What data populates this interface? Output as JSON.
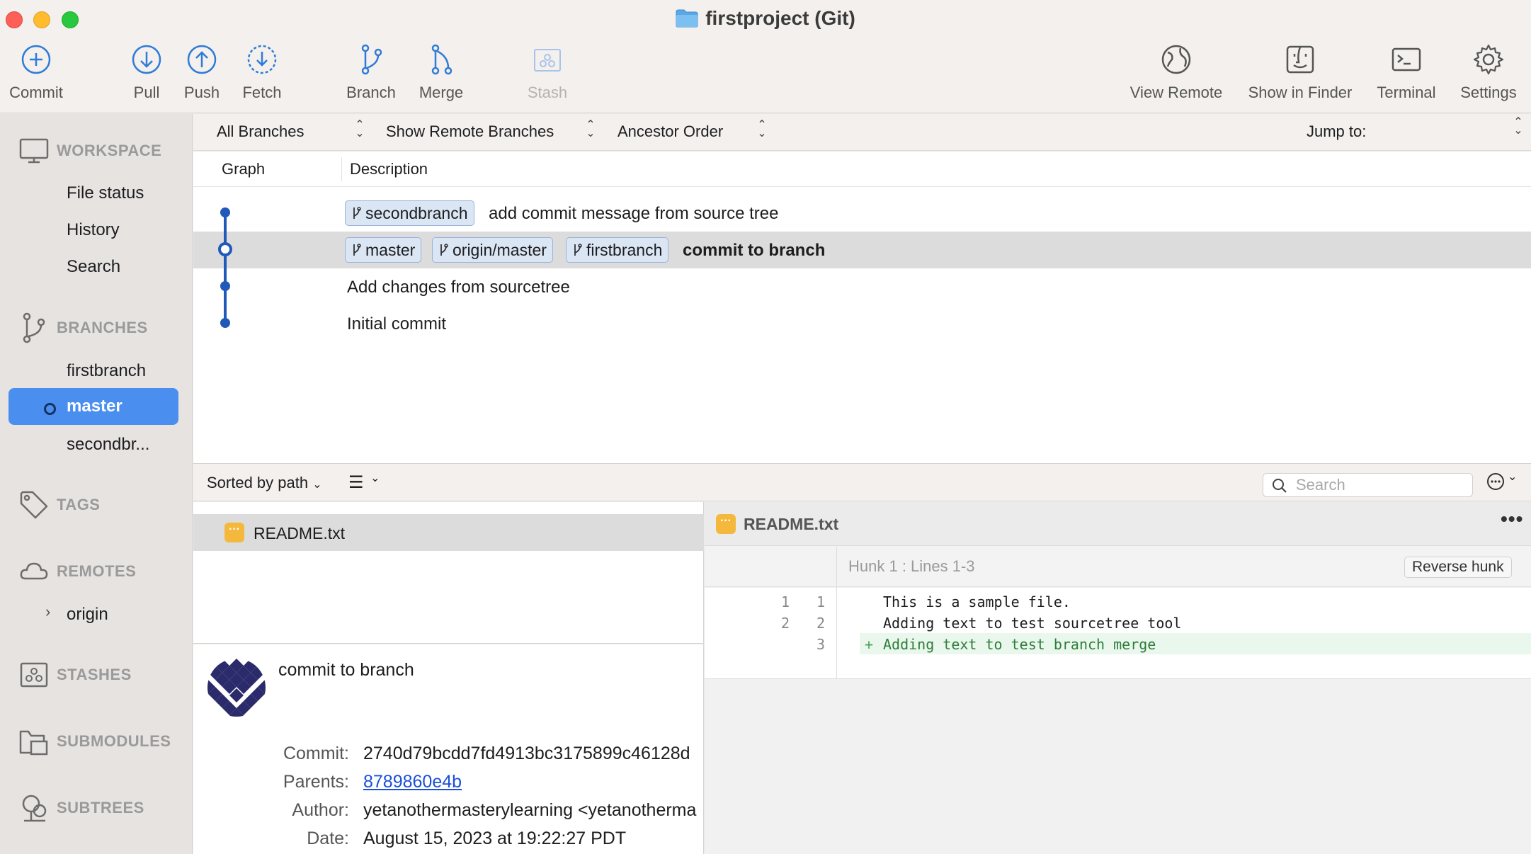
{
  "window": {
    "title": "firstproject (Git)"
  },
  "toolbar": {
    "commit": "Commit",
    "pull": "Pull",
    "push": "Push",
    "fetch": "Fetch",
    "branch": "Branch",
    "merge": "Merge",
    "stash": "Stash",
    "view_remote": "View Remote",
    "show_in_finder": "Show in Finder",
    "terminal": "Terminal",
    "settings": "Settings"
  },
  "sidebar": {
    "workspace": "WORKSPACE",
    "workspace_items": [
      "File status",
      "History",
      "Search"
    ],
    "branches": "BRANCHES",
    "branch_items": [
      "firstbranch",
      "master",
      "secondbr..."
    ],
    "tags": "TAGS",
    "remotes": "REMOTES",
    "remote_items": [
      "origin"
    ],
    "stashes": "STASHES",
    "submodules": "SUBMODULES",
    "subtrees": "SUBTREES"
  },
  "filters": {
    "branches": "All Branches",
    "remote": "Show Remote Branches",
    "order": "Ancestor Order",
    "jump": "Jump to:"
  },
  "columns": {
    "graph": "Graph",
    "description": "Description"
  },
  "commits": [
    {
      "tags": [
        "secondbranch"
      ],
      "message": "add commit message from source tree"
    },
    {
      "tags": [
        "master",
        "origin/master",
        "firstbranch"
      ],
      "message": "commit to branch"
    },
    {
      "tags": [],
      "message": "Add changes from sourcetree"
    },
    {
      "tags": [],
      "message": "Initial commit"
    }
  ],
  "lowerbar": {
    "sort": "Sorted by path",
    "search_placeholder": "Search"
  },
  "files": [
    "README.txt"
  ],
  "details": {
    "subject": "commit to branch",
    "commit_label": "Commit:",
    "commit": "2740d79bcdd7fd4913bc3175899c46128d",
    "parents_label": "Parents:",
    "parents": "8789860e4b",
    "author_label": "Author:",
    "author": "yetanothermasterylearning <yetanotherma",
    "date_label": "Date:",
    "date": "August 15, 2023 at 19:22:27 PDT"
  },
  "diff": {
    "file": "README.txt",
    "hunk": "Hunk 1 : Lines 1-3",
    "reverse_hunk": "Reverse hunk",
    "lines": [
      {
        "old": "1",
        "new": "1",
        "text": "This is a sample file.",
        "added": false
      },
      {
        "old": "2",
        "new": "2",
        "text": "Adding text to test sourcetree tool",
        "added": false
      },
      {
        "old": "",
        "new": "3",
        "text": "Adding text to test branch merge",
        "added": true
      }
    ]
  },
  "colors": {
    "accent": "#4a8ef0",
    "graph": "#2159b8",
    "tag_bg": "#dbe6f5",
    "added_bg": "#e9f7ec"
  }
}
